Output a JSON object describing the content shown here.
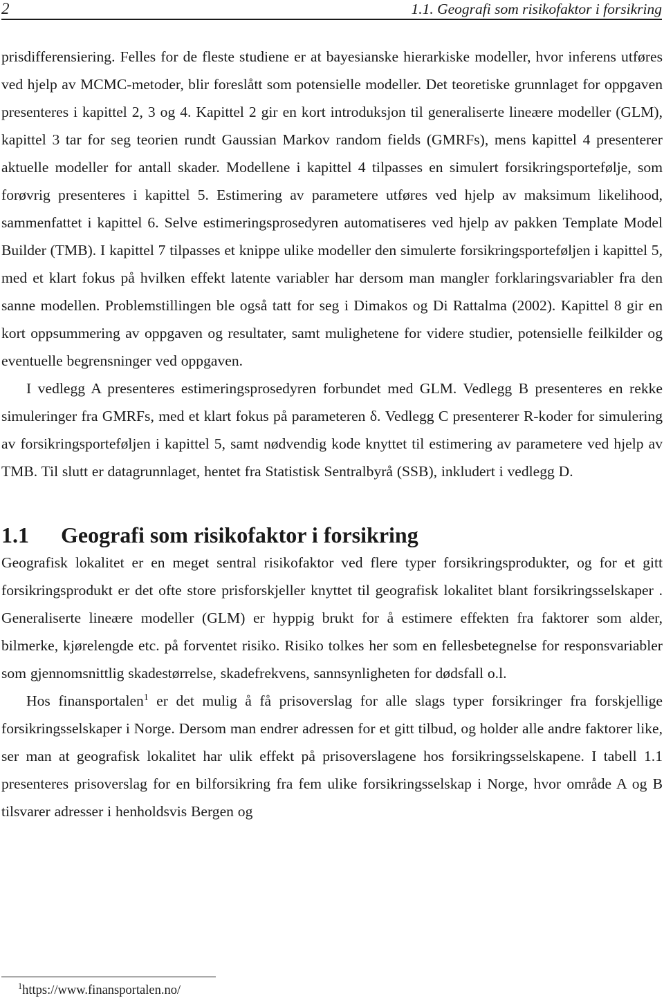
{
  "header": {
    "folio": "2",
    "running_title": "1.1.  Geografi som risikofaktor i forsikring"
  },
  "body": {
    "paragraphs": [
      {
        "id": "para-intro-continued",
        "indent": false,
        "text": "prisdifferensiering. Felles for de fleste studiene er at bayesianske hierarkiske modeller, hvor inferens utføres ved hjelp av MCMC-metoder, blir foreslått som potensielle modeller. Det teoretiske grunnlaget for oppgaven presenteres i kapittel 2, 3 og 4. Kapittel 2 gir en kort introduksjon til generaliserte lineære modeller (GLM), kapittel 3 tar for seg teorien rundt Gaussian Markov random fields (GMRFs), mens kapittel 4 presenterer aktuelle modeller for antall skader. Modellene i kapittel 4 tilpasses en simulert forsikringsportefølje, som forøvrig presenteres i kapittel 5. Estimering av parametere utføres ved hjelp av maksimum likelihood, sammenfattet i kapittel 6. Selve estimeringsprosedyren automatiseres ved hjelp av pakken Template Model Builder (TMB). I kapittel 7 tilpasses et knippe ulike modeller den simulerte forsikringsporteføljen i kapittel 5, med et klart fokus på hvilken effekt latente variabler har dersom man mangler forklaringsvariabler fra den sanne modellen. Problemstillingen ble også tatt for seg i Dimakos og Di Rattalma (2002). Kapittel 8 gir en kort oppsummering av oppgaven og resultater, samt mulighetene for videre studier, potensielle feilkilder og eventuelle begrensninger ved oppgaven."
      },
      {
        "id": "para-appendices",
        "indent": true,
        "text": "I vedlegg A presenteres estimeringsprosedyren forbundet med GLM. Vedlegg B presenteres en rekke simuleringer fra GMRFs, med et klart fokus på parameteren δ. Vedlegg C presenterer R-koder for simulering av forsikringsporteføljen i kapittel 5, samt nødvendig kode knyttet til estimering av parametere ved hjelp av TMB. Til slutt er datagrunnlaget, hentet fra Statistisk Sentralbyrå (SSB), inkludert i vedlegg D."
      }
    ]
  },
  "section": {
    "number": "1.1",
    "title": "Geografi som risikofaktor i forsikring",
    "paragraphs": [
      {
        "id": "para-geography-1",
        "indent": false,
        "text": "Geografisk lokalitet er en meget sentral risikofaktor ved flere typer forsikringsprodukter, og for et gitt forsikringsprodukt er det ofte store prisforskjeller knyttet til geografisk lokalitet blant forsikringsselskaper . Generaliserte lineære modeller (GLM) er hyppig brukt for å estimere effekten fra faktorer som alder, bilmerke, kjørelengde etc. på forventet risiko. Risiko tolkes her som en fellesbetegnelse for responsvariabler som gjennomsnittlig skadestørrelse, skadefrekvens, sannsynligheten for dødsfall o.l."
      }
    ],
    "footnote_paragraph": {
      "id": "para-geography-2",
      "indent": true,
      "text_before_marker": "Hos finansportalen",
      "marker": "1",
      "text_after_marker": " er det mulig å få prisoverslag for alle slags typer forsikringer fra forskjellige forsikringsselskaper i Norge. Dersom man endrer adressen for et gitt tilbud, og holder alle andre faktorer like, ser man at geografisk lokalitet har ulik effekt på prisoverslagene hos forsikringsselskapene. I tabell 1.1 presenteres prisoverslag for en bilforsikring fra fem ulike forsikringsselskap i Norge, hvor område A og B tilsvarer adresser i henholdsvis Bergen og"
    }
  },
  "footnote": {
    "marker": "1",
    "text": "https://www.finansportalen.no/"
  }
}
